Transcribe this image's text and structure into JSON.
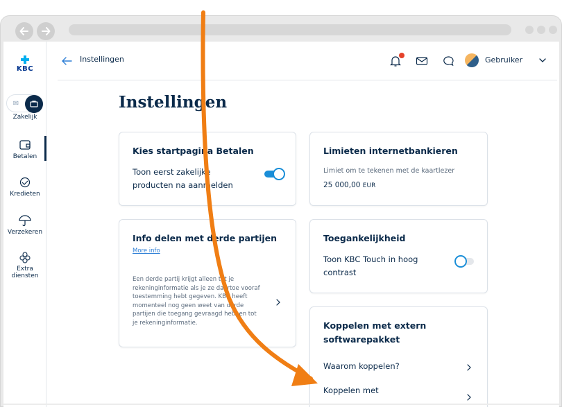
{
  "app": {
    "logo_text": "KBC"
  },
  "sidebar": {
    "items": [
      {
        "label": "Zakelijk",
        "icon": "briefcase-icon"
      },
      {
        "label": "Betalen",
        "icon": "wallet-icon",
        "active": true
      },
      {
        "label": "Kredieten",
        "icon": "handshake-icon"
      },
      {
        "label": "Verzekeren",
        "icon": "umbrella-icon"
      },
      {
        "label_line1": "Extra",
        "label_line2": "diensten",
        "icon": "flower-icon"
      }
    ]
  },
  "header": {
    "back_icon": "arrow-left-icon",
    "title": "Instellingen",
    "user_name": "Gebruiker"
  },
  "main": {
    "page_title": "Instellingen",
    "cards": {
      "startpage": {
        "title": "Kies startpagina Betalen",
        "text_line1": "Toon eerst zakelijke",
        "text_line2": "producten na aanmelden",
        "toggle_on": true
      },
      "limits": {
        "title": "Limieten internetbankieren",
        "subtitle": "Limiet om te tekenen met de kaartlezer",
        "amount": "25 000,00",
        "currency": "EUR"
      },
      "share": {
        "title": "Info delen met derde partijen",
        "link": "More info",
        "text_lines": [
          "Een derde partij krijgt alleen tot je",
          "rekeninginformatie als je ze daartoe vooraf",
          "toestemming hebt gegeven. KBC heeft",
          "momenteel nog geen weet van derde",
          "partijen die toegang gevraagd hebben tot",
          "je rekeninginformatie."
        ]
      },
      "accessibility": {
        "title": "Toegankelijkheid",
        "text_line1": "Toon KBC Touch in hoog",
        "text_line2": "contrast",
        "toggle_on": false
      },
      "connect": {
        "title_line1": "Koppelen met extern",
        "title_line2": "softwarepakket",
        "link1": "Waarom koppelen?",
        "link2": "Koppelen met"
      }
    }
  },
  "colors": {
    "navy": "#0b2a4a",
    "accent_blue": "#1a8ed8",
    "link_blue": "#2e7fd6",
    "notification_red": "#e5422b",
    "annotation_orange": "#f07e14"
  }
}
